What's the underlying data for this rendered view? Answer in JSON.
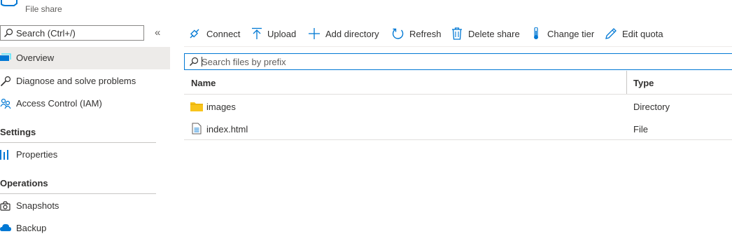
{
  "header": {
    "subtitle": "File share"
  },
  "sidebar": {
    "search_placeholder": "Search (Ctrl+/)",
    "collapse_glyph": "«",
    "items": [
      {
        "label": "Overview",
        "icon": "overview-icon",
        "selected": true
      },
      {
        "label": "Diagnose and solve problems",
        "icon": "wrench-icon"
      },
      {
        "label": "Access Control (IAM)",
        "icon": "people-icon"
      }
    ],
    "sections": [
      {
        "title": "Settings",
        "items": [
          {
            "label": "Properties",
            "icon": "properties-icon"
          }
        ]
      },
      {
        "title": "Operations",
        "items": [
          {
            "label": "Snapshots",
            "icon": "snapshot-icon"
          },
          {
            "label": "Backup",
            "icon": "backup-icon"
          }
        ]
      }
    ]
  },
  "toolbar": {
    "connect": "Connect",
    "upload": "Upload",
    "add_directory": "Add directory",
    "refresh": "Refresh",
    "delete_share": "Delete share",
    "change_tier": "Change tier",
    "edit_quota": "Edit quota"
  },
  "file_search": {
    "placeholder": "Search files by prefix"
  },
  "grid": {
    "columns": [
      "Name",
      "Type"
    ],
    "rows": [
      {
        "name": "images",
        "type": "Directory",
        "icon": "folder-icon"
      },
      {
        "name": "index.html",
        "type": "File",
        "icon": "file-icon"
      }
    ]
  },
  "colors": {
    "accent": "#0078d4",
    "folder": "#f8c41c",
    "selected_bg": "#edebe9"
  }
}
